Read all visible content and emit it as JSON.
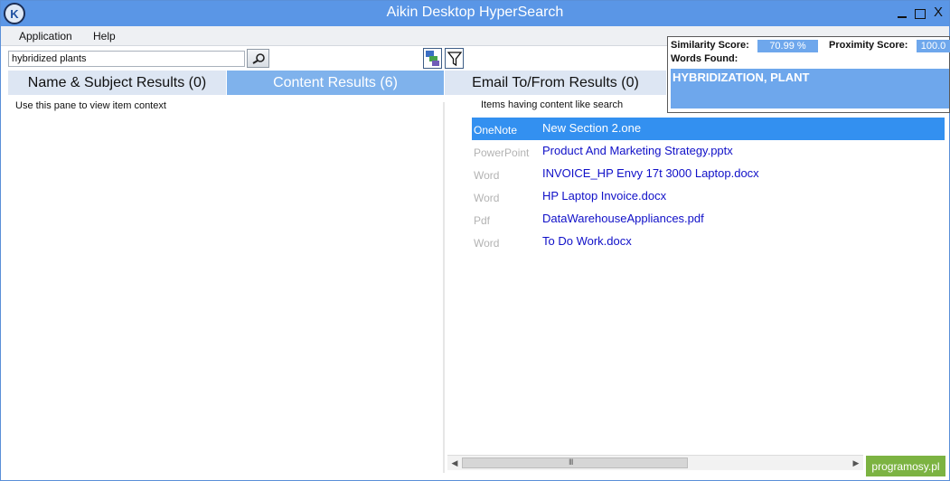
{
  "window": {
    "title": "Aikin Desktop HyperSearch",
    "close_label": "X"
  },
  "menu": {
    "items": [
      {
        "label": "Application"
      },
      {
        "label": "Help"
      }
    ]
  },
  "search": {
    "value": "hybridized plants"
  },
  "tabs": [
    {
      "label": "Name & Subject Results (0)"
    },
    {
      "label": "Content Results (6)",
      "active": true
    },
    {
      "label": "Email To/From Results (0)"
    }
  ],
  "left_pane": {
    "hint": "Use this pane to view item context"
  },
  "right_pane": {
    "hint": "Items having content like search",
    "results": [
      {
        "type": "OneNote",
        "name": "New Section 2.one",
        "selected": true
      },
      {
        "type": "PowerPoint",
        "name": "Product And Marketing Strategy.pptx"
      },
      {
        "type": "Word",
        "name": "INVOICE_HP Envy 17t 3000 Laptop.docx"
      },
      {
        "type": "Word",
        "name": "HP Laptop Invoice.docx"
      },
      {
        "type": "Pdf",
        "name": "DataWarehouseAppliances.pdf"
      },
      {
        "type": "Word",
        "name": "To Do Work.docx"
      }
    ]
  },
  "score_panel": {
    "similarity_label": "Similarity Score:",
    "similarity_value": "70.99 %",
    "proximity_label": "Proximity Score:",
    "proximity_value": "100.0",
    "words_label": "Words Found:",
    "words_value": "HYBRIDIZATION, PLANT"
  },
  "scrollbar": {
    "grip": "III"
  },
  "watermark": "programosy.pl",
  "colors": {
    "titlebar": "#5a96e6",
    "active_tab": "#7fb2ec",
    "selected_row": "#3390f0",
    "link": "#1010c8"
  }
}
